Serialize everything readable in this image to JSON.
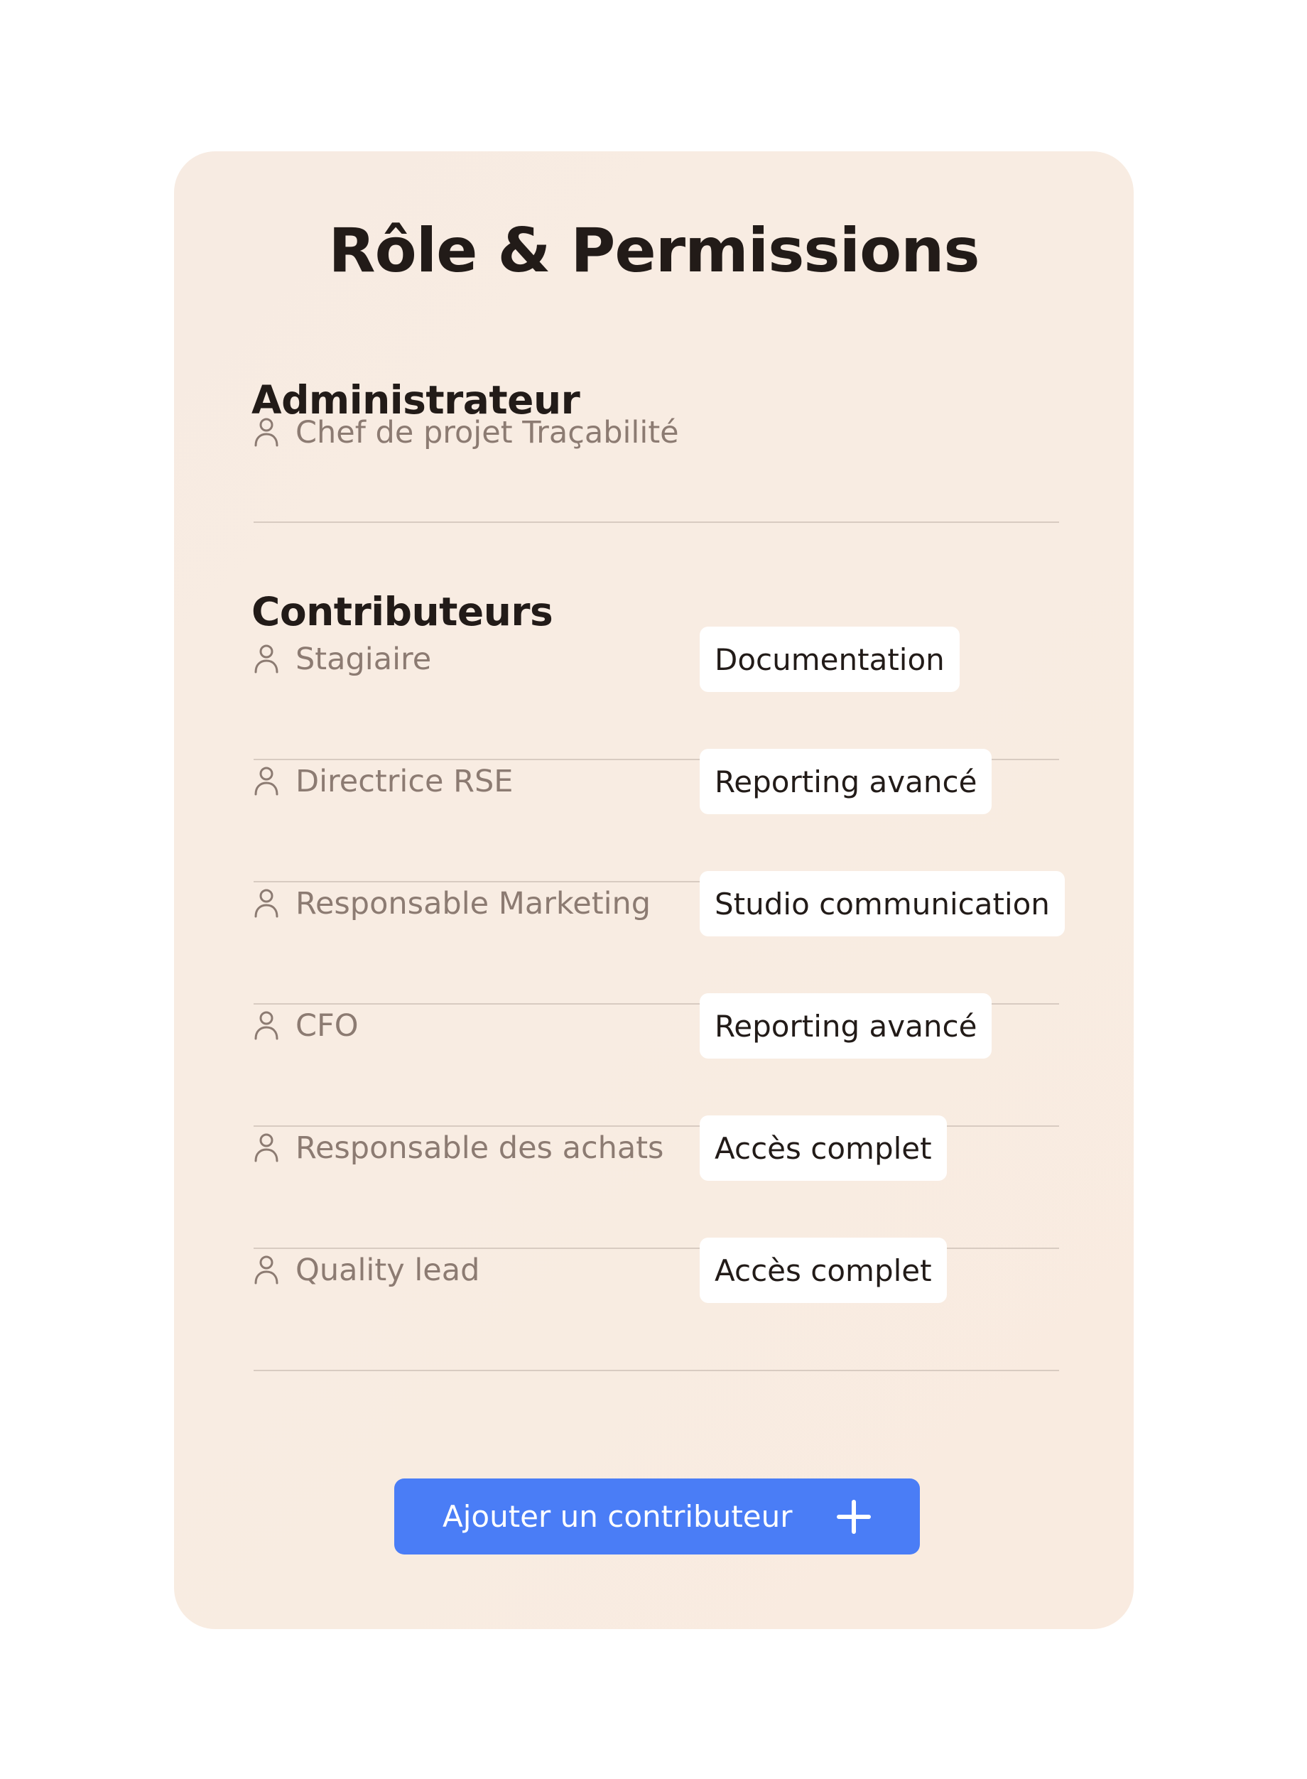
{
  "card": {
    "title": "Rôle & Permissions"
  },
  "admin": {
    "heading": "Administrateur",
    "person": {
      "label": "Chef de projet Traçabilité",
      "icon": "user-icon"
    }
  },
  "contributors": {
    "heading": "Contributeurs",
    "items": [
      {
        "label": "Stagiaire",
        "permission": "Documentation",
        "icon": "user-icon"
      },
      {
        "label": "Directrice RSE",
        "permission": "Reporting avancé",
        "icon": "user-icon"
      },
      {
        "label": "Responsable Marketing",
        "permission": "Studio communication",
        "icon": "user-icon"
      },
      {
        "label": "CFO",
        "permission": "Reporting avancé",
        "icon": "user-icon"
      },
      {
        "label": "Responsable des achats",
        "permission": "Accès complet",
        "icon": "user-icon"
      },
      {
        "label": "Quality lead",
        "permission": "Accès complet",
        "icon": "user-icon"
      }
    ]
  },
  "add_button": {
    "label": "Ajouter un contributeur",
    "icon": "plus-icon"
  },
  "colors": {
    "card_background": "#f8ece2",
    "accent": "#4a7df6",
    "heading_text": "#221b18",
    "muted_text": "#8c7b72"
  }
}
